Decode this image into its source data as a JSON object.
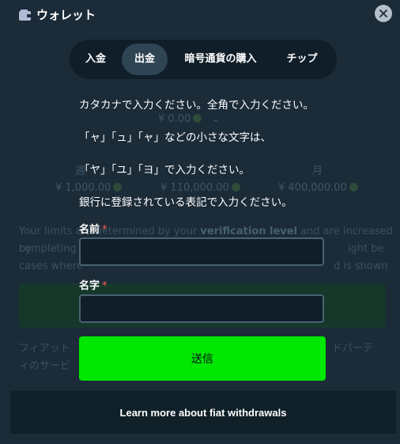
{
  "header": {
    "title": "ウォレット",
    "wallet_icon": "wallet-icon",
    "close_icon": "close-icon"
  },
  "tabs": [
    {
      "label": "入金",
      "active": false
    },
    {
      "label": "出金",
      "active": true
    },
    {
      "label": "暗号通貨の購入",
      "active": false
    },
    {
      "label": "チップ",
      "active": false
    }
  ],
  "background": {
    "amount": "¥ 0.00",
    "period_partial_left": "週",
    "period_partial_right": "月",
    "limits": [
      "¥ 1,000.00",
      "¥ 110,000.00",
      "¥ 400,000.00"
    ],
    "limits_text_lines": [
      "Your limits are determined by your",
      "verification level",
      "and are increased by",
      "completing",
      "ight be",
      "cases where",
      "d is shown"
    ],
    "fiat_text_left_1": "フィアット",
    "fiat_text_left_2": "ィのサービ",
    "fiat_text_right": "ドパーテ"
  },
  "instructions": [
    "カタカナで入力ください。全角で入力ください。",
    "「ャ」「ュ」「ャ」などの小さな文字は、",
    "「ヤ」「ユ」「ヨ」で入力ください。",
    "銀行に登録されている表記で入力ください。"
  ],
  "form": {
    "first_name_label": "名前",
    "last_name_label": "名字",
    "required_mark": "*",
    "first_name_value": "",
    "last_name_value": "",
    "submit_label": "送信"
  },
  "footer": {
    "link_text": "Learn more about fiat withdrawals"
  },
  "colors": {
    "accent_green": "#00e701",
    "background": "#1b2b38",
    "panel": "#0f1e29",
    "required": "#ff5a5a"
  }
}
